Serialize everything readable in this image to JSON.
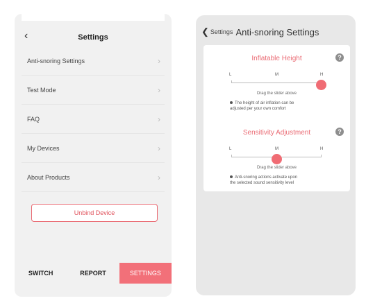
{
  "left_screen": {
    "header": {
      "title": "Settings",
      "back_icon": "chevron-left-icon"
    },
    "menu": [
      {
        "label": "Anti-snoring Settings"
      },
      {
        "label": "Test Mode"
      },
      {
        "label": "FAQ"
      },
      {
        "label": "My Devices"
      },
      {
        "label": "About Products"
      }
    ],
    "unbind_label": "Unbind Device",
    "bottom_nav": [
      {
        "label": "SWITCH"
      },
      {
        "label": "REPORT"
      },
      {
        "label": "SETTINGS",
        "active": true
      }
    ]
  },
  "right_screen": {
    "header": {
      "back_label": "Settings",
      "title": "Anti-snoring Settings",
      "back_icon": "chevron-left-icon"
    },
    "inflatable": {
      "title": "Inflatable Height",
      "ticks": [
        "L",
        "M",
        "H"
      ],
      "selected": "H",
      "hint": "Drag the slider above",
      "note_line1": "The height of air inflation can be",
      "note_line2": "adjusted per your own comfort"
    },
    "sensitivity": {
      "title": "Sensitivity Adjustment",
      "ticks": [
        "L",
        "M",
        "H"
      ],
      "selected": "M",
      "hint": "Drag the slider above",
      "note_line1": "Anti-snoring actions activate upon",
      "note_line2": "the selected sound sensitivity level"
    },
    "help_icon_text": "?"
  },
  "colors": {
    "accent": "#f27079",
    "accent_text": "#e0505a",
    "background": "#f1f1f1"
  }
}
